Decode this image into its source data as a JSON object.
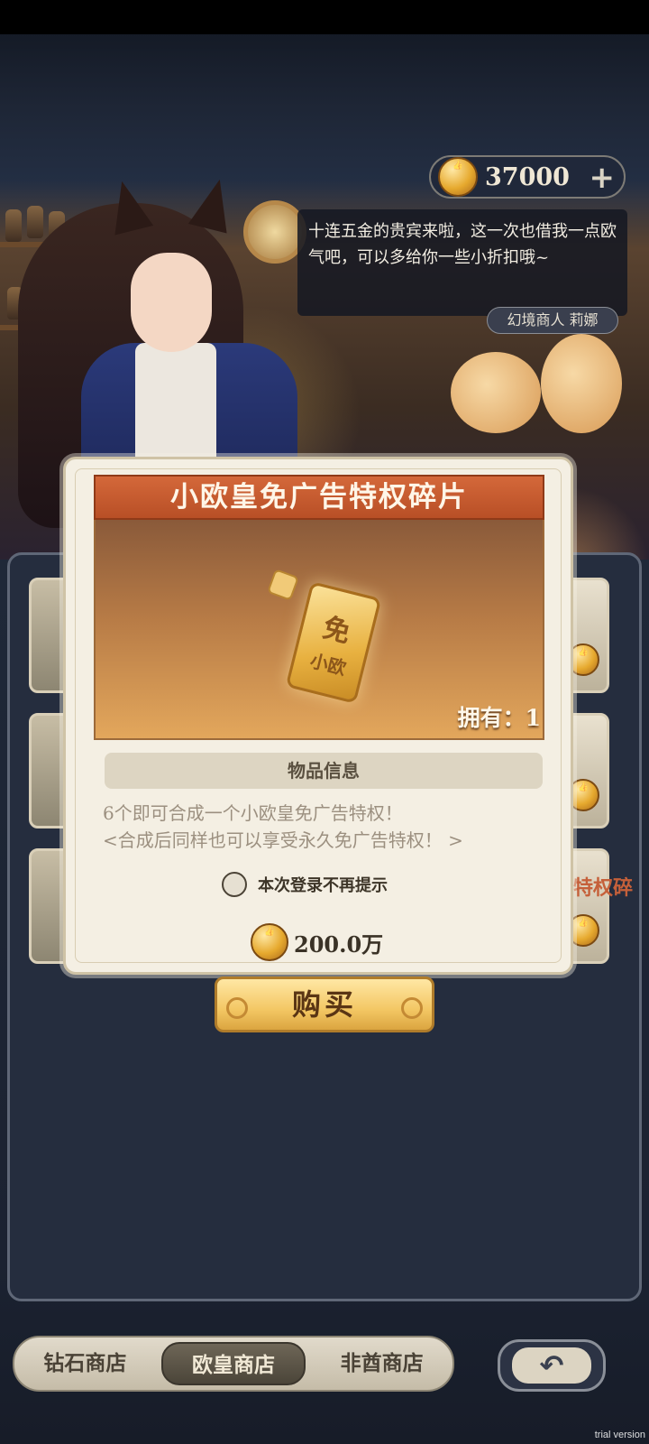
{
  "currency": {
    "amount": "37000",
    "plus_icon": "plus-icon"
  },
  "npc": {
    "speech": "十连五金的贵宾来啦，这一次也借我一点欧气吧，可以多给你一些小折扣哦~",
    "name": "幻境商人 莉娜"
  },
  "dialog": {
    "title": "小欧皇免广告特权碎片",
    "ticket_big": "免",
    "ticket_small": "小欧",
    "owned": "拥有：1",
    "info_header": "物品信息",
    "desc_line1": "6个即可合成一个小欧皇免广告特权！",
    "desc_line2": "<合成后同样也可以享受永久免广告特权！ >",
    "checkbox_label": "本次登录不再提示",
    "price": "200.0万",
    "buy_label": "购买"
  },
  "background": {
    "side_text": "特权碎"
  },
  "tabs": [
    {
      "label": "钻石商店",
      "active": false
    },
    {
      "label": "欧皇商店",
      "active": true
    },
    {
      "label": "非酋商店",
      "active": false
    }
  ],
  "back_icon": "back-arrow-icon",
  "watermark": "trial version",
  "colors": {
    "banner": "#c45a2e",
    "button": "#f3c764",
    "panel": "#252d3e"
  }
}
